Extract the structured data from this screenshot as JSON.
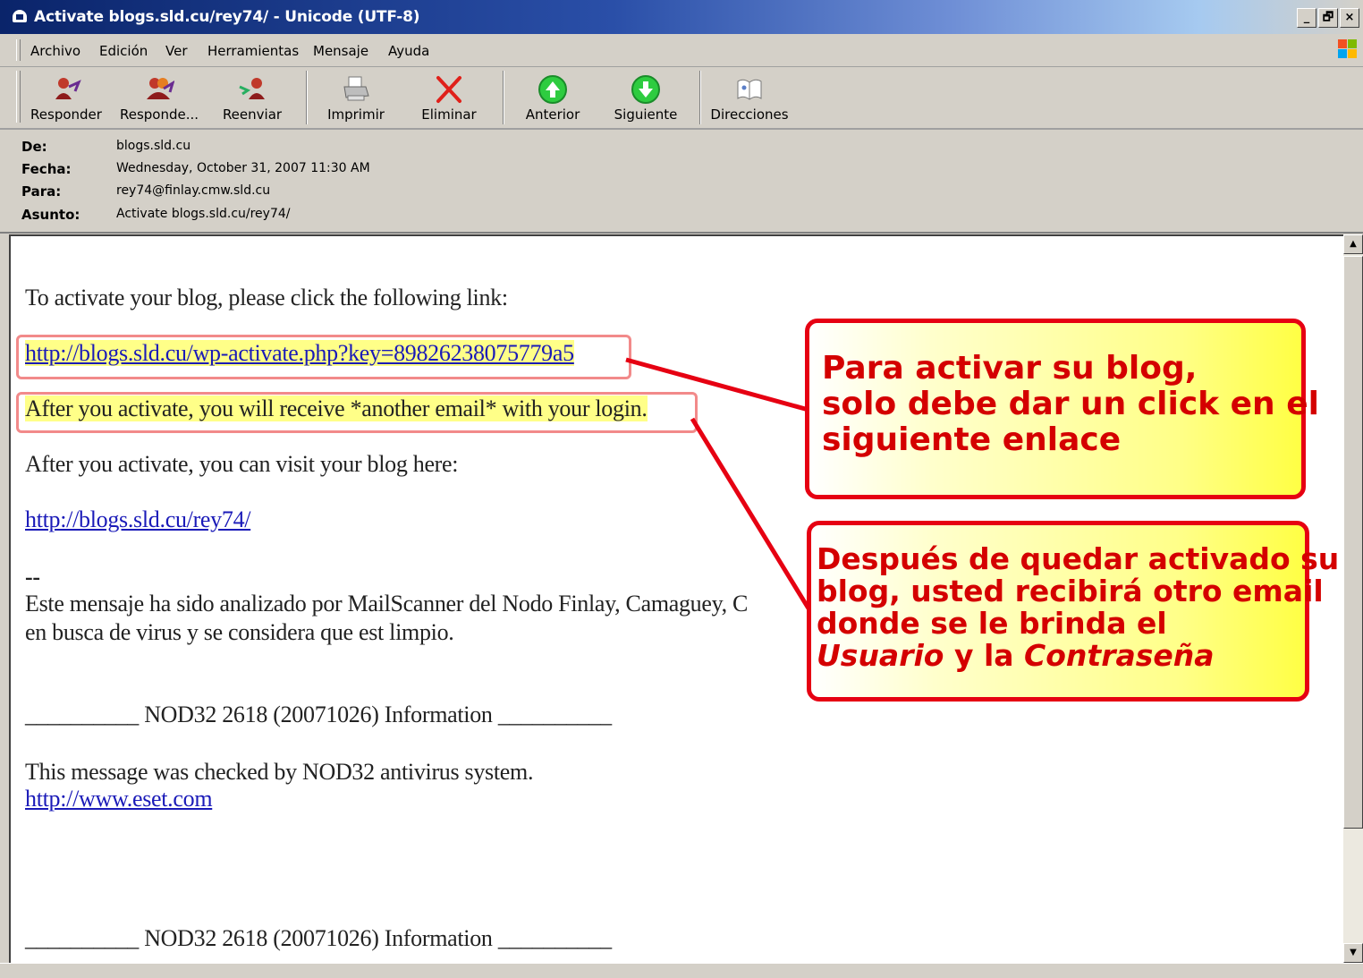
{
  "window": {
    "title": "Activate blogs.sld.cu/rey74/ - Unicode (UTF-8)",
    "controls": [
      "_",
      "🗗",
      "×"
    ]
  },
  "menu": [
    "Archivo",
    "Edición",
    "Ver",
    "Herramientas",
    "Mensaje",
    "Ayuda"
  ],
  "toolbar": [
    {
      "label": "Responder",
      "icon": "reply-icon"
    },
    {
      "label": "Responde...",
      "icon": "reply-all-icon"
    },
    {
      "label": "Reenviar",
      "icon": "forward-icon"
    },
    {
      "label": "Imprimir",
      "icon": "printer-icon"
    },
    {
      "label": "Eliminar",
      "icon": "delete-icon"
    },
    {
      "label": "Anterior",
      "icon": "previous-icon"
    },
    {
      "label": "Siguiente",
      "icon": "next-icon"
    },
    {
      "label": "Direcciones",
      "icon": "address-book-icon"
    }
  ],
  "headers": {
    "from_label": "De:",
    "from": "blogs.sld.cu",
    "date_label": "Fecha:",
    "date": "Wednesday, October 31, 2007 11:30 AM",
    "to_label": "Para:",
    "to": "rey74@finlay.cmw.sld.cu",
    "subject_label": "Asunto:",
    "subject": "Activate blogs.sld.cu/rey74/"
  },
  "body": {
    "intro": "To activate your blog, please click the following link:",
    "activate_link": "http://blogs.sld.cu/wp-activate.php?key=89826238075779a5",
    "after_activate": "After you activate, you will receive *another email* with your login.",
    "visit_text": "After you activate, you can visit your blog here:",
    "blog_link": "http://blogs.sld.cu/rey74/",
    "sig_dash": "--",
    "scanner_1": "Este mensaje ha sido analizado por MailScanner del Nodo Finlay, Camaguey, C",
    "scanner_2": "en busca de virus y se considera que est limpio.",
    "nod32_line_1": "__________ NOD32 2618 (20071026) Information __________",
    "nod32_checked": "This message was checked by NOD32 antivirus system.",
    "eset_link": "http://www.eset.com",
    "nod32_line_2": "__________ NOD32 2618 (20071026) Information __________"
  },
  "callouts": {
    "one": [
      "Para activar su blog,",
      "solo debe dar un click en el",
      "siguiente enlace"
    ],
    "two_line1": "Después de quedar activado su",
    "two_line2": "blog, usted recibirá otro email",
    "two_line3": "donde se le brinda el",
    "two_usuario": "Usuario",
    "two_y_la": " y la ",
    "two_contrasena": "Contraseña"
  },
  "colors": {
    "callout_border": "#e60012",
    "callout_text": "#d40000",
    "highlight": "#ffff88",
    "link": "#1a1ab8"
  }
}
